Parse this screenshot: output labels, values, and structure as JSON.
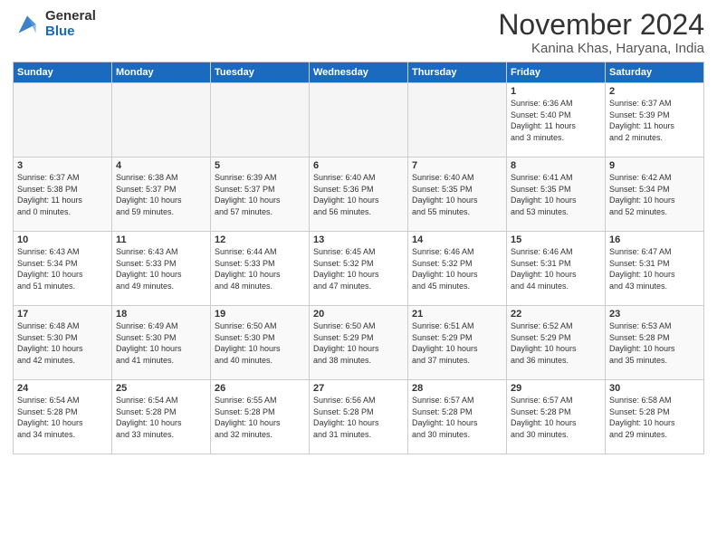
{
  "logo": {
    "general": "General",
    "blue": "Blue"
  },
  "title": "November 2024",
  "location": "Kanina Khas, Haryana, India",
  "headers": [
    "Sunday",
    "Monday",
    "Tuesday",
    "Wednesday",
    "Thursday",
    "Friday",
    "Saturday"
  ],
  "weeks": [
    [
      {
        "day": "",
        "info": ""
      },
      {
        "day": "",
        "info": ""
      },
      {
        "day": "",
        "info": ""
      },
      {
        "day": "",
        "info": ""
      },
      {
        "day": "",
        "info": ""
      },
      {
        "day": "1",
        "info": "Sunrise: 6:36 AM\nSunset: 5:40 PM\nDaylight: 11 hours\nand 3 minutes."
      },
      {
        "day": "2",
        "info": "Sunrise: 6:37 AM\nSunset: 5:39 PM\nDaylight: 11 hours\nand 2 minutes."
      }
    ],
    [
      {
        "day": "3",
        "info": "Sunrise: 6:37 AM\nSunset: 5:38 PM\nDaylight: 11 hours\nand 0 minutes."
      },
      {
        "day": "4",
        "info": "Sunrise: 6:38 AM\nSunset: 5:37 PM\nDaylight: 10 hours\nand 59 minutes."
      },
      {
        "day": "5",
        "info": "Sunrise: 6:39 AM\nSunset: 5:37 PM\nDaylight: 10 hours\nand 57 minutes."
      },
      {
        "day": "6",
        "info": "Sunrise: 6:40 AM\nSunset: 5:36 PM\nDaylight: 10 hours\nand 56 minutes."
      },
      {
        "day": "7",
        "info": "Sunrise: 6:40 AM\nSunset: 5:35 PM\nDaylight: 10 hours\nand 55 minutes."
      },
      {
        "day": "8",
        "info": "Sunrise: 6:41 AM\nSunset: 5:35 PM\nDaylight: 10 hours\nand 53 minutes."
      },
      {
        "day": "9",
        "info": "Sunrise: 6:42 AM\nSunset: 5:34 PM\nDaylight: 10 hours\nand 52 minutes."
      }
    ],
    [
      {
        "day": "10",
        "info": "Sunrise: 6:43 AM\nSunset: 5:34 PM\nDaylight: 10 hours\nand 51 minutes."
      },
      {
        "day": "11",
        "info": "Sunrise: 6:43 AM\nSunset: 5:33 PM\nDaylight: 10 hours\nand 49 minutes."
      },
      {
        "day": "12",
        "info": "Sunrise: 6:44 AM\nSunset: 5:33 PM\nDaylight: 10 hours\nand 48 minutes."
      },
      {
        "day": "13",
        "info": "Sunrise: 6:45 AM\nSunset: 5:32 PM\nDaylight: 10 hours\nand 47 minutes."
      },
      {
        "day": "14",
        "info": "Sunrise: 6:46 AM\nSunset: 5:32 PM\nDaylight: 10 hours\nand 45 minutes."
      },
      {
        "day": "15",
        "info": "Sunrise: 6:46 AM\nSunset: 5:31 PM\nDaylight: 10 hours\nand 44 minutes."
      },
      {
        "day": "16",
        "info": "Sunrise: 6:47 AM\nSunset: 5:31 PM\nDaylight: 10 hours\nand 43 minutes."
      }
    ],
    [
      {
        "day": "17",
        "info": "Sunrise: 6:48 AM\nSunset: 5:30 PM\nDaylight: 10 hours\nand 42 minutes."
      },
      {
        "day": "18",
        "info": "Sunrise: 6:49 AM\nSunset: 5:30 PM\nDaylight: 10 hours\nand 41 minutes."
      },
      {
        "day": "19",
        "info": "Sunrise: 6:50 AM\nSunset: 5:30 PM\nDaylight: 10 hours\nand 40 minutes."
      },
      {
        "day": "20",
        "info": "Sunrise: 6:50 AM\nSunset: 5:29 PM\nDaylight: 10 hours\nand 38 minutes."
      },
      {
        "day": "21",
        "info": "Sunrise: 6:51 AM\nSunset: 5:29 PM\nDaylight: 10 hours\nand 37 minutes."
      },
      {
        "day": "22",
        "info": "Sunrise: 6:52 AM\nSunset: 5:29 PM\nDaylight: 10 hours\nand 36 minutes."
      },
      {
        "day": "23",
        "info": "Sunrise: 6:53 AM\nSunset: 5:28 PM\nDaylight: 10 hours\nand 35 minutes."
      }
    ],
    [
      {
        "day": "24",
        "info": "Sunrise: 6:54 AM\nSunset: 5:28 PM\nDaylight: 10 hours\nand 34 minutes."
      },
      {
        "day": "25",
        "info": "Sunrise: 6:54 AM\nSunset: 5:28 PM\nDaylight: 10 hours\nand 33 minutes."
      },
      {
        "day": "26",
        "info": "Sunrise: 6:55 AM\nSunset: 5:28 PM\nDaylight: 10 hours\nand 32 minutes."
      },
      {
        "day": "27",
        "info": "Sunrise: 6:56 AM\nSunset: 5:28 PM\nDaylight: 10 hours\nand 31 minutes."
      },
      {
        "day": "28",
        "info": "Sunrise: 6:57 AM\nSunset: 5:28 PM\nDaylight: 10 hours\nand 30 minutes."
      },
      {
        "day": "29",
        "info": "Sunrise: 6:57 AM\nSunset: 5:28 PM\nDaylight: 10 hours\nand 30 minutes."
      },
      {
        "day": "30",
        "info": "Sunrise: 6:58 AM\nSunset: 5:28 PM\nDaylight: 10 hours\nand 29 minutes."
      }
    ]
  ]
}
